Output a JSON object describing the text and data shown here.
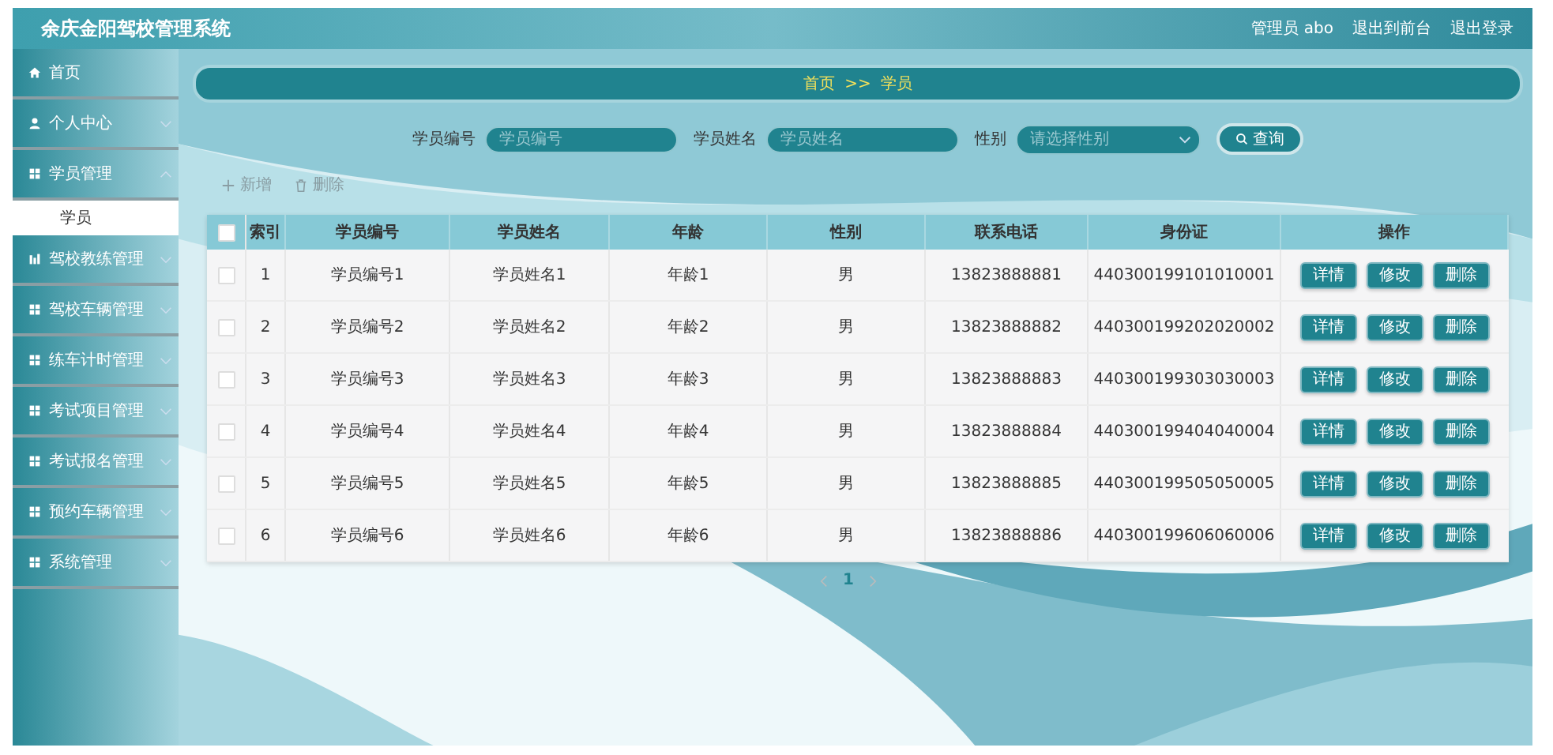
{
  "header": {
    "title": "余庆金阳驾校管理系统",
    "links": [
      "管理员 abo",
      "退出到前台",
      "退出登录"
    ]
  },
  "sidebar": {
    "items": [
      {
        "label": "首页",
        "kind": "link"
      },
      {
        "label": "个人中心",
        "kind": "group",
        "expanded": false
      },
      {
        "label": "学员管理",
        "kind": "group",
        "expanded": true,
        "children": [
          {
            "label": "学员",
            "selected": true
          }
        ]
      },
      {
        "label": "驾校教练管理",
        "kind": "group",
        "expanded": false
      },
      {
        "label": "驾校车辆管理",
        "kind": "group",
        "expanded": false
      },
      {
        "label": "练车计时管理",
        "kind": "group",
        "expanded": false
      },
      {
        "label": "考试项目管理",
        "kind": "group",
        "expanded": false
      },
      {
        "label": "考试报名管理",
        "kind": "group",
        "expanded": false
      },
      {
        "label": "预约车辆管理",
        "kind": "group",
        "expanded": false
      },
      {
        "label": "系统管理",
        "kind": "group",
        "expanded": false
      }
    ]
  },
  "breadcrumb": {
    "items": [
      "首页",
      "学员"
    ],
    "separator": ">>"
  },
  "search": {
    "fields": [
      {
        "label": "学员编号",
        "kind": "input",
        "placeholder": "学员编号"
      },
      {
        "label": "学员姓名",
        "kind": "input",
        "placeholder": "学员姓名"
      },
      {
        "label": "性别",
        "kind": "select",
        "placeholder": "请选择性别"
      }
    ],
    "button": "查询"
  },
  "actions": [
    {
      "label": "新增",
      "kind": "add",
      "disabled": true
    },
    {
      "label": "删除",
      "kind": "delete",
      "disabled": true
    }
  ],
  "table": {
    "columns": [
      "索引",
      "学员编号",
      "学员姓名",
      "年龄",
      "性别",
      "联系电话",
      "身份证",
      "操作"
    ],
    "all_checked": false,
    "rows": [
      {
        "checked": false,
        "cells": [
          "1",
          "学员编号1",
          "学员姓名1",
          "年龄1",
          "男",
          "13823888881",
          "440300199101010001"
        ],
        "buttons": [
          "详情",
          "修改",
          "删除"
        ]
      },
      {
        "checked": false,
        "cells": [
          "2",
          "学员编号2",
          "学员姓名2",
          "年龄2",
          "男",
          "13823888882",
          "440300199202020002"
        ],
        "buttons": [
          "详情",
          "修改",
          "删除"
        ]
      },
      {
        "checked": false,
        "cells": [
          "3",
          "学员编号3",
          "学员姓名3",
          "年龄3",
          "男",
          "13823888883",
          "440300199303030003"
        ],
        "buttons": [
          "详情",
          "修改",
          "删除"
        ]
      },
      {
        "checked": false,
        "cells": [
          "4",
          "学员编号4",
          "学员姓名4",
          "年龄4",
          "男",
          "13823888884",
          "440300199404040004"
        ],
        "buttons": [
          "详情",
          "修改",
          "删除"
        ]
      },
      {
        "checked": false,
        "cells": [
          "5",
          "学员编号5",
          "学员姓名5",
          "年龄5",
          "男",
          "13823888885",
          "440300199505050005"
        ],
        "buttons": [
          "详情",
          "修改",
          "删除"
        ]
      },
      {
        "checked": false,
        "cells": [
          "6",
          "学员编号6",
          "学员姓名6",
          "年龄6",
          "男",
          "13823888886",
          "440300199606060006"
        ],
        "buttons": [
          "详情",
          "修改",
          "删除"
        ]
      }
    ]
  },
  "pagination": {
    "pages": [
      {
        "label": "1",
        "selected": true
      }
    ]
  }
}
